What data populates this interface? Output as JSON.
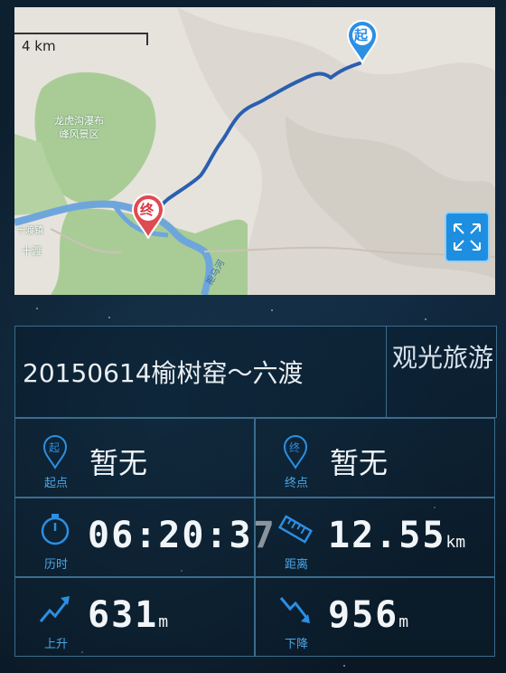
{
  "map": {
    "scale_label": "4 km",
    "start_pin": "起",
    "end_pin": "终",
    "area_label_line1": "龙虎沟瀑布",
    "area_label_line2": "峰风景区",
    "town_label_1": "十渡镇",
    "town_label_2": "十渡",
    "river_label": "拒马河"
  },
  "trip": {
    "title": "20150614榆树窑～六渡",
    "category": "观光旅游"
  },
  "stats": {
    "start": {
      "icon_label": "起点",
      "icon_char": "起",
      "value": "暂无"
    },
    "end": {
      "icon_label": "终点",
      "icon_char": "终",
      "value": "暂无"
    },
    "duration": {
      "icon_label": "历时",
      "value": "06:20:37"
    },
    "distance": {
      "icon_label": "距离",
      "value": "12.55",
      "unit": "km"
    },
    "ascent": {
      "icon_label": "上升",
      "value": "631",
      "unit": "m"
    },
    "descent": {
      "icon_label": "下降",
      "value": "956",
      "unit": "m"
    }
  },
  "colors": {
    "accent": "#1e8fe0",
    "route": "#2a5fb0",
    "label": "#4aa8e8"
  }
}
